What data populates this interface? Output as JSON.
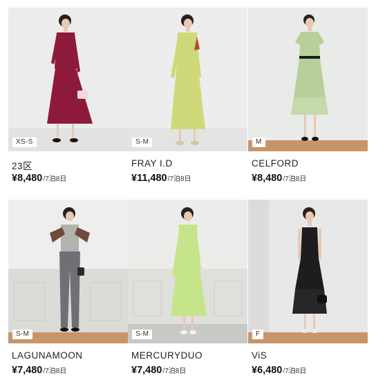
{
  "products": [
    {
      "brand": "23区",
      "price": "¥8,480",
      "period": "/7泊8日",
      "size": "XS-S",
      "dress_color": "#8e1a3b",
      "dress_icon": "lace-dress-icon"
    },
    {
      "brand": "FRAY I.D",
      "price": "¥11,480",
      "period": "/7泊8日",
      "size": "S-M",
      "dress_color": "#cfd97a",
      "dress_icon": "lace-dress-icon"
    },
    {
      "brand": "CELFORD",
      "price": "¥8,480",
      "period": "/7泊8日",
      "size": "M",
      "dress_color": "#b9cf9a",
      "dress_icon": "tiered-dress-icon"
    },
    {
      "brand": "LAGUNAMOON",
      "price": "¥7,480",
      "period": "/7泊8日",
      "size": "S-M",
      "dress_color": "#6f6f74",
      "dress_icon": "pantsuit-icon"
    },
    {
      "brand": "MERCURYDUO",
      "price": "¥7,480",
      "period": "/7泊8日",
      "size": "S-M",
      "dress_color": "#c6e58a",
      "dress_icon": "lace-dress-icon"
    },
    {
      "brand": "ViS",
      "price": "¥6,480",
      "period": "/7泊8日",
      "size": "F",
      "dress_color": "#1d1d1f",
      "dress_icon": "tiered-dress-icon"
    }
  ]
}
